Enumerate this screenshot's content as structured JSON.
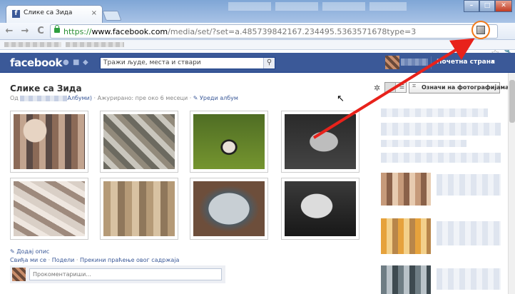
{
  "browser": {
    "tab_title": "Слике са Зида",
    "tab_favicon": "f",
    "tab_close": "×",
    "url_scheme": "https://",
    "url_host": "www.facebook.com",
    "url_path": "/media/set/?set=a.485739842167.234495.5363571678type=3",
    "back_icon": "←",
    "forward_icon": "→",
    "reload_icon": "C",
    "star_icon": "☆",
    "wrench_icon": "🔧"
  },
  "fb": {
    "logo": "facebook",
    "search_placeholder": "Тражи људе, места и ствари",
    "search_icon": "⚲",
    "home": "Почетна страна",
    "caret": "▾"
  },
  "album": {
    "title": "Слике са Зида",
    "meta_from": "Од",
    "meta_albums": "Албуми)",
    "meta_separator": "·",
    "meta_updated": "Ажурирано: пре око 6 месеци",
    "meta_edit": "Уреди албум",
    "tag_button": "Означи на фотографијама",
    "add_description": "Додај опис",
    "like": "Свиђа ми се",
    "share": "Подели",
    "stop_follow": "Прекини праћење овог садржаја",
    "comment_placeholder": "Прокоментариши..."
  },
  "colors": {
    "fb_blue": "#3b5998",
    "arrow_red": "#e8221b",
    "highlight_orange": "#f07a1b"
  }
}
